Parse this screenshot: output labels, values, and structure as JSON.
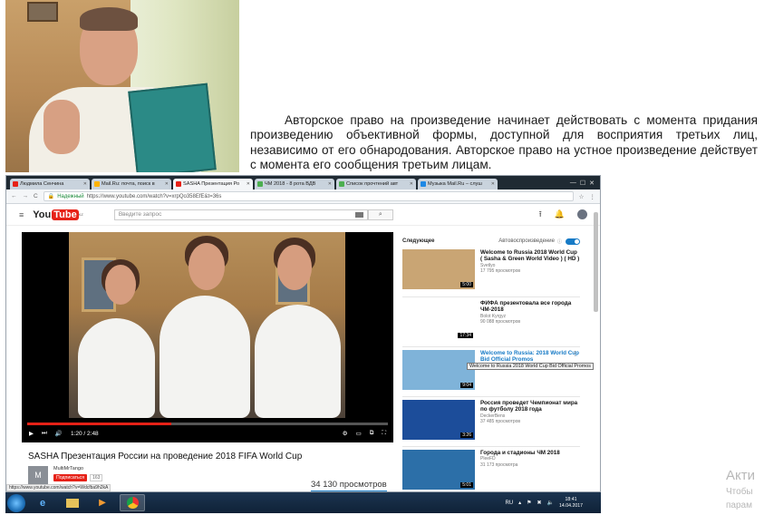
{
  "quote": "Авторское право на произведение начинает действовать с момента придания произведению объективной формы, доступной для восприятия третьих лиц, независимо от его обнародования. Авторское право на устное произведение действует с момента его сообщения третьим лицам.",
  "browser": {
    "tabs": [
      {
        "label": "Людмила Сенчина",
        "color": "#e62117"
      },
      {
        "label": "Mail.Ru: почта, поиск в",
        "color": "#ffb300"
      },
      {
        "label": "SASHA Презентация Ро",
        "color": "#e62117",
        "active": true
      },
      {
        "label": "ЧМ 2018 - 8 рота ВДВ",
        "color": "#4caf50"
      },
      {
        "label": "Список прочтений авт",
        "color": "#4caf50"
      },
      {
        "label": "Музыка Mail.Ru – слуш",
        "color": "#1e88e5"
      }
    ],
    "address": {
      "secure_label": "Надежный",
      "url": "https://www.youtube.com/watch?v=xrpQo358EfE&t=36s"
    },
    "status_url": "https://www.youtube.com/watch?v=Wdcfba9h2kA"
  },
  "youtube": {
    "logo_you": "You",
    "logo_tube": "Tube",
    "logo_region": "KZ",
    "search_placeholder": "Введите запрос",
    "time": "1:20 / 2:48",
    "progress_fraction": 0.4,
    "video_title": "SASHA Презентация России на проведение 2018 FIFA World Cup",
    "channel_initial": "M",
    "channel_name": "MultiMrTango",
    "subscribe_label": "Подписаться",
    "subscriber_count": "163",
    "views": "34 130 просмотров",
    "next_label": "Следующее",
    "autoplay_label": "Автовоспроизведение",
    "tooltip": "Welcome to Russia 2018 World Cup Bid Official Promos",
    "recommendations": [
      {
        "title": "Welcome to Russia 2018 World Cup ( Sasha & Green World Video ) ( HD )",
        "channel": "Svetlyo",
        "views": "17 795 просмотров",
        "duration": "5:00",
        "thumb": "#c9a574"
      },
      {
        "title": "ФИФА презентовала все города ЧМ-2018",
        "channel": "Bolot Kyrgyz",
        "views": "90 088 просмотров",
        "duration": "17:34",
        "thumb": "#ffffff"
      },
      {
        "title": "Welcome to Russia: 2018 World Cup Bid Official Promos",
        "channel": "",
        "views": "1 394 634 просмотра",
        "duration": "9:04",
        "thumb": "#7fb3d9"
      },
      {
        "title": "Россия проведет Чемпионат мира по футболу 2018 года",
        "channel": "DeckerBens",
        "views": "37 485 просмотров",
        "duration": "3:26",
        "thumb": "#1c4d9a"
      },
      {
        "title": "Города и стадионы ЧМ 2018",
        "channel": "PleeFD",
        "views": "31 173 просмотра",
        "duration": "5:01",
        "thumb": "#2c6fa8"
      }
    ]
  },
  "taskbar": {
    "lang": "RU",
    "time": "18:41",
    "date": "14.04.2017"
  },
  "watermark": {
    "line1": "Акти",
    "line2": "Чтобы",
    "line3": "парам"
  }
}
